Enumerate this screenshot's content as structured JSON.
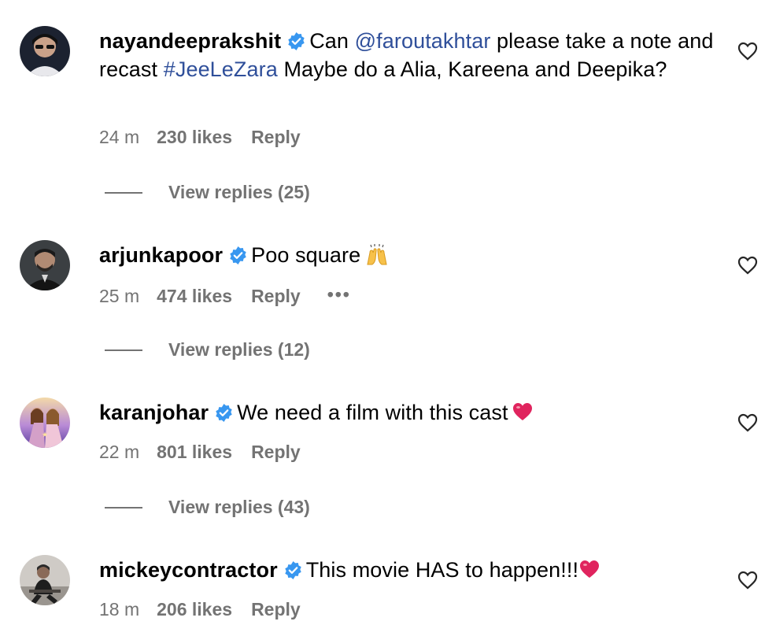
{
  "comments": [
    {
      "username": "nayandeeprakshit",
      "text_before": "Can ",
      "mention": "@faroutakhtar",
      "text_middle": " please take a note and recast ",
      "hashtag": "#JeeLeZara",
      "text_after": " Maybe do a Alia, Kareena and Deepika?",
      "time": "24 m",
      "likes": "230 likes",
      "reply": "Reply",
      "view_replies": "View replies (25)",
      "avatar_icon": "person-sunglasses-avatar"
    },
    {
      "username": "arjunkapoor",
      "text": "Poo square",
      "emoji": "raising-hands",
      "time": "25 m",
      "likes": "474 likes",
      "reply": "Reply",
      "more": "•••",
      "view_replies": "View replies (12)",
      "avatar_icon": "person-suit-avatar"
    },
    {
      "username": "karanjohar",
      "text": "We need a film with this cast",
      "emoji": "red-heart",
      "time": "22 m",
      "likes": "801 likes",
      "reply": "Reply",
      "view_replies": "View replies (43)",
      "avatar_icon": "movie-poster-avatar"
    },
    {
      "username": "mickeycontractor",
      "text": "This movie HAS to happen!!!",
      "emoji": "red-heart",
      "time": "18 m",
      "likes": "206 likes",
      "reply": "Reply",
      "avatar_icon": "person-chair-avatar"
    }
  ],
  "colors": {
    "verified_badge": "#3897f0",
    "link": "#2f4f9a",
    "meta_gray": "#737373",
    "heart_emoji": "#e0245e"
  }
}
